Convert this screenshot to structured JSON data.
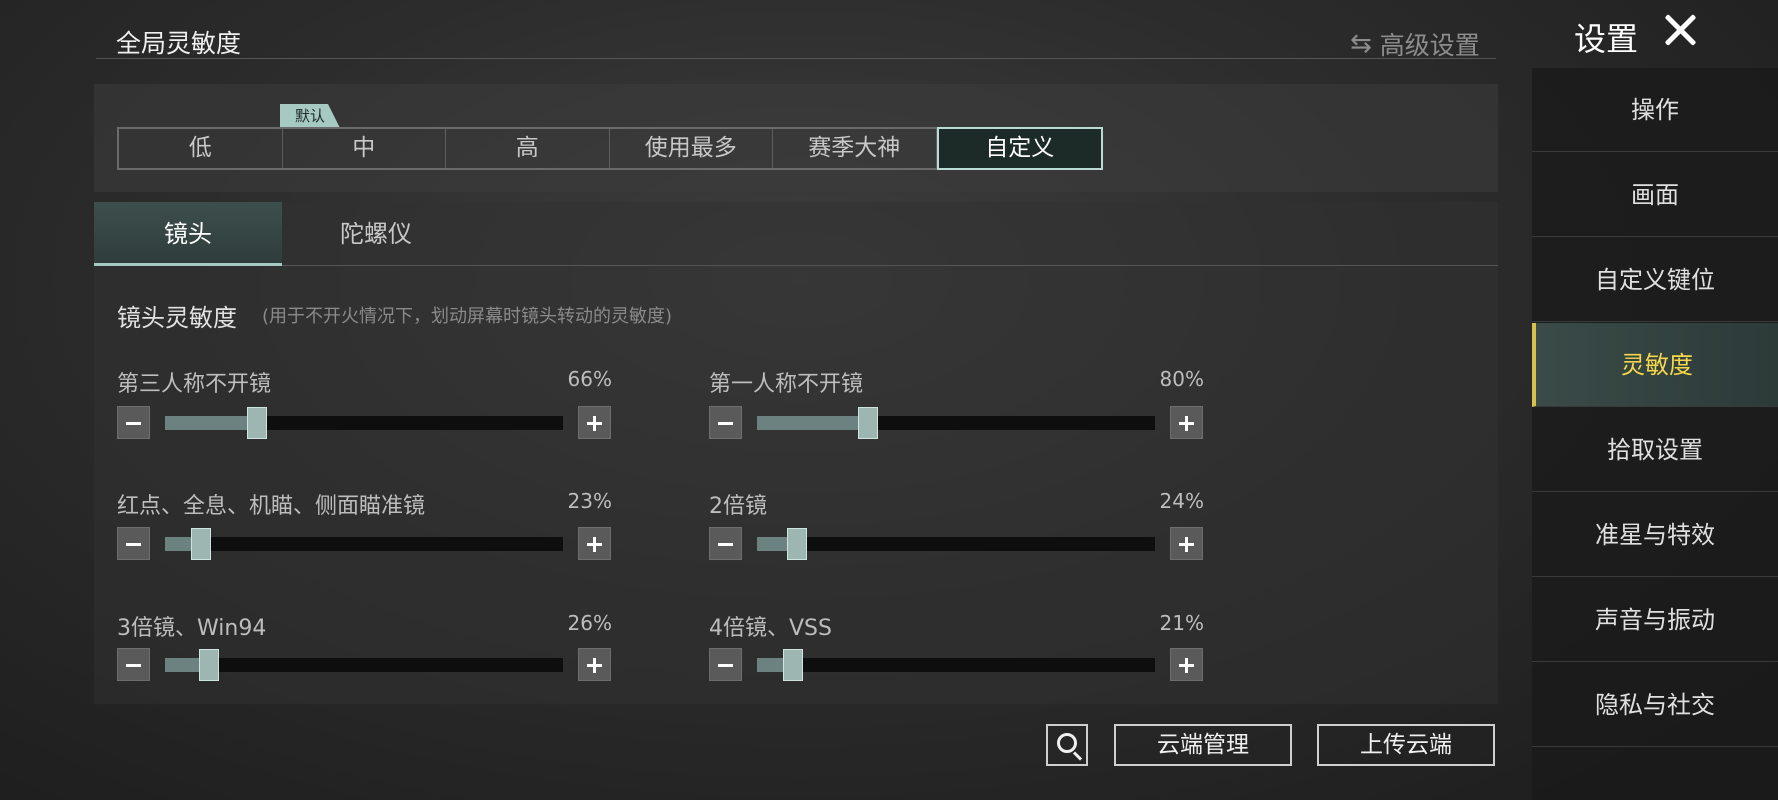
{
  "header": {
    "page_title": "全局灵敏度",
    "advanced_label": "高级设置",
    "settings_title": "设置"
  },
  "presets": {
    "default_badge": "默认",
    "items": [
      "低",
      "中",
      "高",
      "使用最多",
      "赛季大神",
      "自定义"
    ],
    "selected": "自定义"
  },
  "tabs": [
    "镜头",
    "陀螺仪"
  ],
  "section": {
    "title": "镜头灵敏度",
    "description": "(用于不开火情况下，划动屏幕时镜头转动的灵敏度)"
  },
  "sliders": [
    {
      "label": "第三人称不开镜",
      "value": "66%",
      "level": 0.23
    },
    {
      "label": "第一人称不开镜",
      "value": "80%",
      "level": 0.28
    },
    {
      "label": "红点、全息、机瞄、侧面瞄准镜",
      "value": "23%",
      "level": 0.09
    },
    {
      "label": "2倍镜",
      "value": "24%",
      "level": 0.1
    },
    {
      "label": "3倍镜、Win94",
      "value": "26%",
      "level": 0.11
    },
    {
      "label": "4倍镜、VSS",
      "value": "21%",
      "level": 0.09
    }
  ],
  "bottom_buttons": {
    "cloud_manage": "云端管理",
    "upload_cloud": "上传云端"
  },
  "sidebar": {
    "items": [
      "操作",
      "画面",
      "自定义键位",
      "灵敏度",
      "拾取设置",
      "准星与特效",
      "声音与振动",
      "隐私与社交"
    ],
    "active": "灵敏度"
  },
  "colors": {
    "accent": "#a6c9c2",
    "active_sidebar_text": "#f6d64a",
    "slider_fill": "#6c8280"
  }
}
